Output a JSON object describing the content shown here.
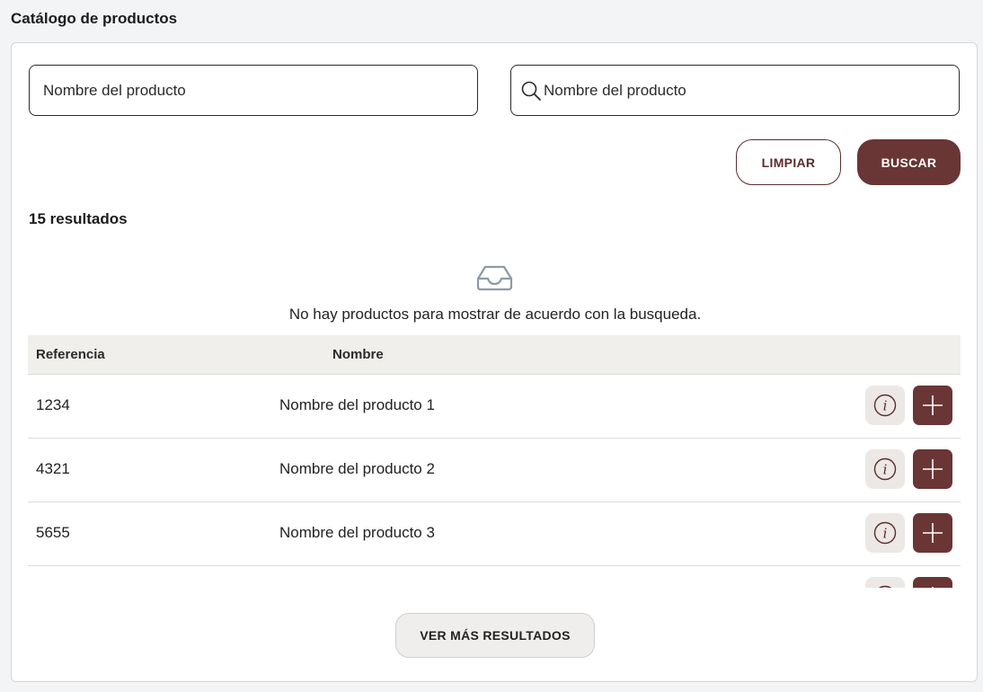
{
  "page": {
    "title": "Catálogo de productos"
  },
  "filters": {
    "name_placeholder": "Nombre del producto",
    "search_placeholder": "Nombre del producto",
    "clear_label": "LIMPIAR",
    "search_label": "BUSCAR"
  },
  "results": {
    "count_label": "15 resultados",
    "empty_message": "No hay productos para mostrar de acuerdo con la busqueda."
  },
  "table": {
    "columns": [
      "Referencia",
      "Nombre"
    ],
    "rows": [
      {
        "ref": "1234",
        "name": "Nombre del producto 1"
      },
      {
        "ref": "4321",
        "name": "Nombre del producto 2"
      },
      {
        "ref": "5655",
        "name": "Nombre del producto 3"
      },
      {
        "ref": "",
        "name": ""
      }
    ]
  },
  "footer": {
    "more_label": "VER MÁS RESULTADOS"
  },
  "colors": {
    "brand": "#6a3535",
    "info_bg": "#ece8e6",
    "header_bg": "#f0efec",
    "page_bg": "#f3f4f6"
  },
  "icons": {
    "search": "search-icon",
    "empty": "inbox-icon",
    "info": "info-icon",
    "add": "plus-icon"
  }
}
